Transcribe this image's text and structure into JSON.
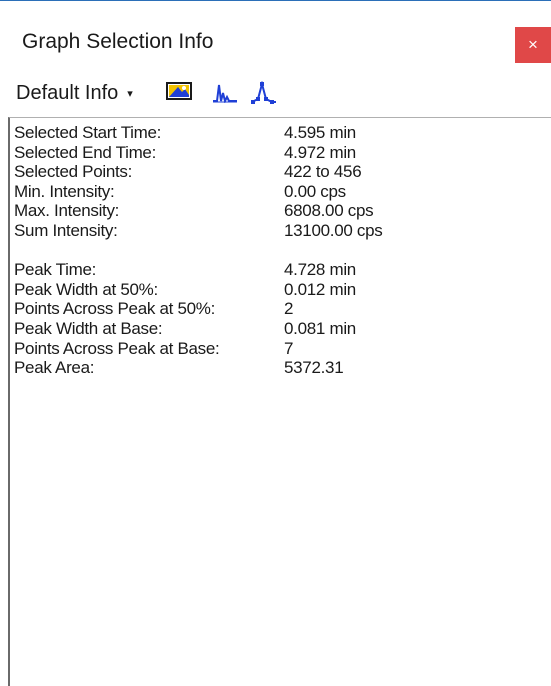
{
  "window": {
    "title": "Graph Selection Info",
    "close_glyph": "×"
  },
  "toolbar": {
    "dropdown_label": "Default Info",
    "dropdown_arrow": "▾",
    "icons": [
      "copy-image-icon",
      "peak-chromatogram-icon",
      "peak-points-icon"
    ],
    "accent_color": "#1f3fd6"
  },
  "info": {
    "group1": [
      {
        "label": "Selected Start Time:",
        "value": "4.595 min"
      },
      {
        "label": "Selected End Time:",
        "value": "4.972 min"
      },
      {
        "label": "Selected Points:",
        "value": "422 to 456"
      },
      {
        "label": "Min. Intensity:",
        "value": "0.00 cps"
      },
      {
        "label": "Max. Intensity:",
        "value": "6808.00 cps"
      },
      {
        "label": "Sum Intensity:",
        "value": "13100.00 cps"
      }
    ],
    "group2": [
      {
        "label": "Peak Time:",
        "value": "4.728 min"
      },
      {
        "label": "Peak Width at 50%:",
        "value": "0.012 min"
      },
      {
        "label": "Points Across Peak at 50%:",
        "value": "2"
      },
      {
        "label": "Peak Width at Base:",
        "value": "0.081 min"
      },
      {
        "label": "Points Across Peak at Base:",
        "value": "7"
      },
      {
        "label": "Peak Area:",
        "value": "5372.31"
      }
    ]
  }
}
